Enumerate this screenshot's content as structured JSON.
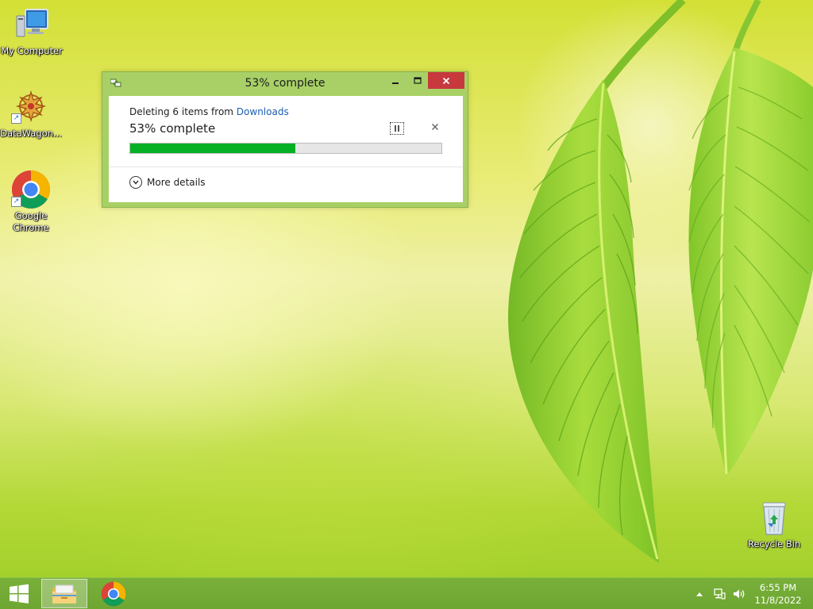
{
  "desktop": {
    "icons": [
      {
        "label": "My Computer",
        "icon": "computer-icon"
      },
      {
        "label": "DataWagon...",
        "icon": "datawagon-icon"
      },
      {
        "label": "Google Chrome",
        "icon": "chrome-icon"
      },
      {
        "label": "Recycle Bin",
        "icon": "recycle-bin-icon"
      }
    ]
  },
  "dialog": {
    "title": "53% complete",
    "description_prefix": "Deleting 6 items from ",
    "description_link": "Downloads",
    "percent_text": "53% complete",
    "progress": 0.53,
    "more_details_label": "More details",
    "controls": {
      "minimize": "minimize-icon",
      "maximize": "maximize-icon",
      "close": "close-icon",
      "pause": "pause-icon",
      "cancel": "cancel-icon"
    }
  },
  "taskbar": {
    "apps": [
      {
        "name": "File Explorer",
        "icon": "file-explorer-icon",
        "active": true
      },
      {
        "name": "Google Chrome",
        "icon": "chrome-icon",
        "active": false
      }
    ],
    "tray_icons": [
      "show-hidden-icons-icon",
      "network-icon",
      "volume-icon"
    ],
    "clock": {
      "time": "6:55 PM",
      "date": "11/8/2022"
    }
  },
  "colors": {
    "progress_fill": "#06b025",
    "dialog_frame": "#a8d066",
    "close_button": "#c7393d",
    "taskbar": "#72aa36",
    "link": "#1a5fb4"
  }
}
